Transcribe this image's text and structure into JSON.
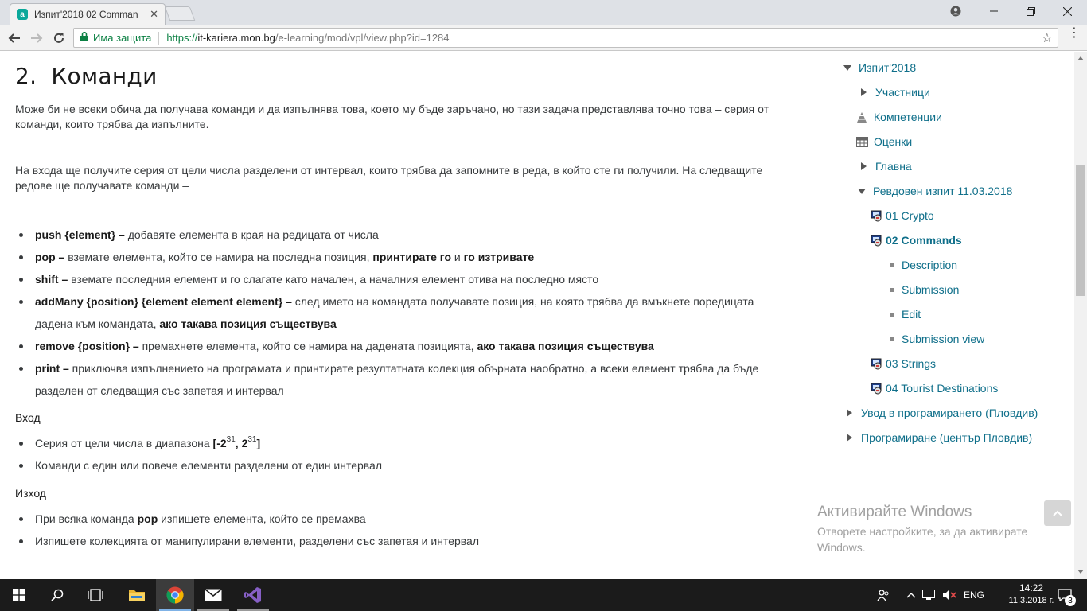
{
  "browser": {
    "tab_title": "Изпит'2018 02 Comman",
    "tab_favicon": "а",
    "secure_label": "Има защита",
    "url_scheme": "https://",
    "url_host": "it-kariera.mon.bg",
    "url_path": "/e-learning/mod/vpl/view.php?id=1284"
  },
  "content": {
    "heading_number": "2.",
    "heading_text": "Команди",
    "intro": "Може би не всеки обича да получава команди и да изпълнява това, което му бъде заръчано, но тази задача представлява точно това – серия от команди, които трябва да изпълните.",
    "input_desc": "На входа ще получите серия от цели числа разделени от интервал, които трябва да запомните в реда, в който сте ги получили. На следващите редове ще получавате команди –",
    "commands": [
      {
        "cmd": "push {element} –",
        "text": " добавяте елемента в края на редицата от числа",
        "bold_tail": "",
        "mid": "",
        "bold_tail2": ""
      },
      {
        "cmd": "pop –",
        "text": " вземате елемента, който се намира на последна позиция, ",
        "bold_tail": "принтирате го",
        "mid": " и ",
        "bold_tail2": "го изтривате"
      },
      {
        "cmd": "shift –",
        "text": " вземате последния елемент и го слагате като начален, а началния елемент отива на последно място",
        "bold_tail": "",
        "mid": "",
        "bold_tail2": ""
      },
      {
        "cmd": "addMany {position} {element element element} –",
        "text": " след името на командата получавате позиция, на която трябва да вмъкнете поредицата дадена към командата, ",
        "bold_tail": "ако такава позиция съществува",
        "mid": "",
        "bold_tail2": ""
      },
      {
        "cmd": "remove {position} –",
        "text": " премахнете елемента, който се намира на дадената позицията, ",
        "bold_tail": "ако такава позиция съществува",
        "mid": "",
        "bold_tail2": ""
      },
      {
        "cmd": "print –",
        "text": " приключва изпълнението на програмата и принтирате резултатната колекция обърната наобратно, а всеки елемент трябва да бъде разделен от следващия със запетая и интервал",
        "bold_tail": "",
        "mid": "",
        "bold_tail2": ""
      }
    ],
    "input_heading": "Вход",
    "input_item1_text": "Серия от цели числа в диапазона ",
    "input_item1_range_open": "[-2",
    "input_item1_exp1": "31",
    "input_item1_mid": ", 2",
    "input_item1_exp2": "31",
    "input_item1_close": "]",
    "input_item2": "Команди с един или повече елементи разделени от един интервал",
    "output_heading": "Изход",
    "output_item1_pre": "При всяка команда ",
    "output_item1_bold": "pop",
    "output_item1_post": " изпишете елемента, който се премахва",
    "output_item2": "Изпишете колекцията от манипулирани елементи, разделени със запетая и интервал"
  },
  "sidebar": {
    "course": "Изпит'2018",
    "participants": "Участници",
    "competencies": "Компетенции",
    "grades": "Оценки",
    "general": "Главна",
    "section": "Ревдовен изпит 11.03.2018",
    "activities": [
      "01 Crypto",
      "02 Commands",
      "03 Strings",
      "04 Tourist Destinations"
    ],
    "sub_items": [
      "Description",
      "Submission",
      "Edit",
      "Submission view"
    ],
    "other_courses": [
      "Увод в програмирането (Пловдив)",
      "Програмиране (център Пловдив)"
    ]
  },
  "watermark": {
    "title": "Активирайте Windows",
    "subtitle": "Отворете настройките, за да активирате Windows."
  },
  "taskbar": {
    "lang": "ENG",
    "time": "14:22",
    "date": "11.3.2018 г.",
    "notifications": "3"
  },
  "colors": {
    "link": "#0f6f8a",
    "secure_green": "#0b8043",
    "taskbar": "#1b1b1b"
  }
}
